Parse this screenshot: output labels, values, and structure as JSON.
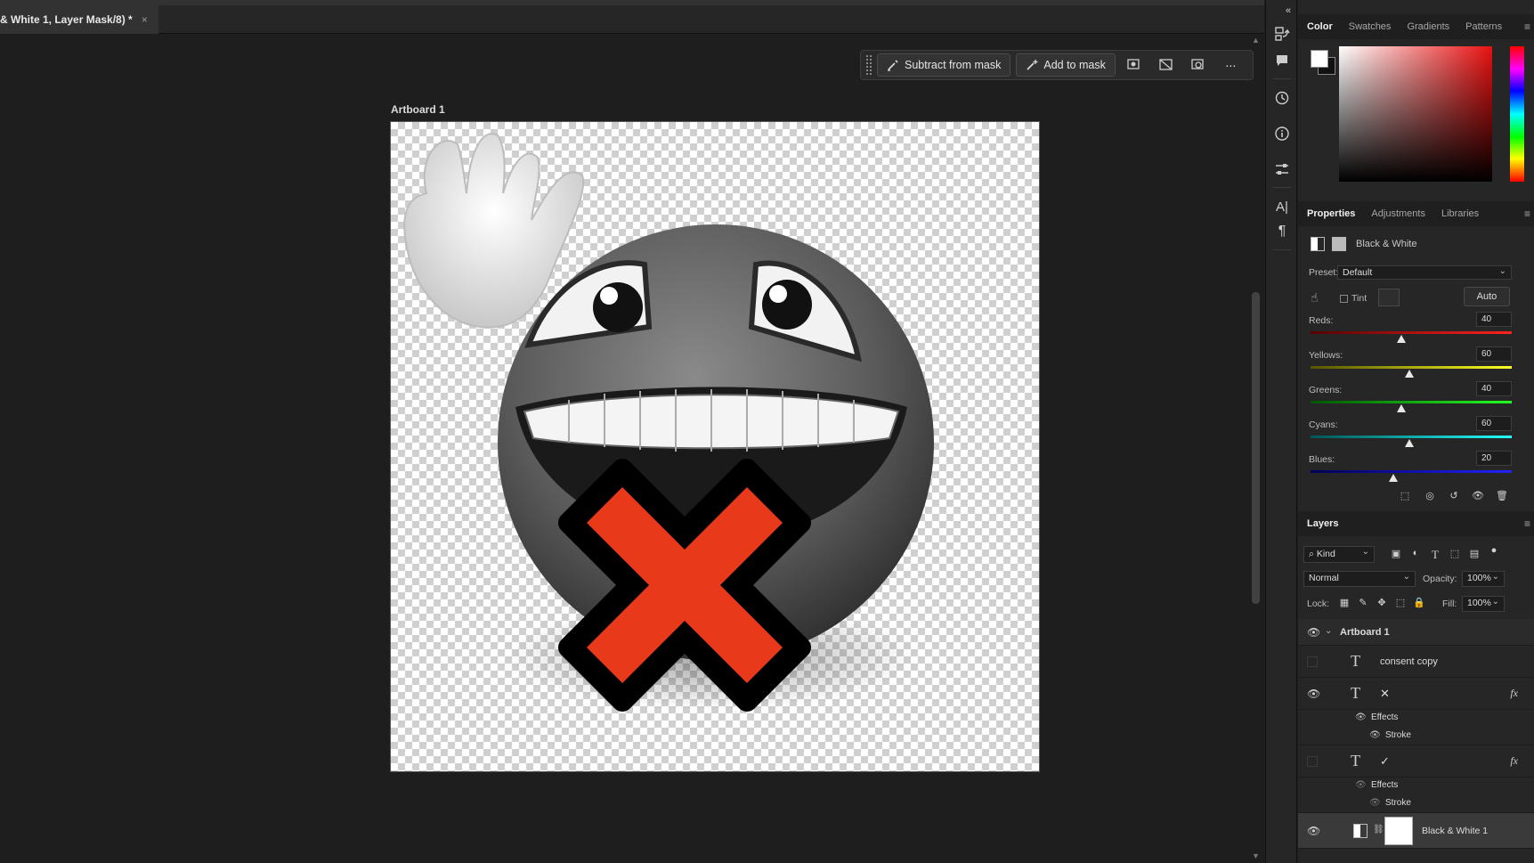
{
  "document": {
    "tab_title": "& White 1, Layer Mask/8) *",
    "close_glyph": "×"
  },
  "taskbar": {
    "subtract_label": "Subtract from mask",
    "add_label": "Add to mask",
    "more_glyph": "···"
  },
  "canvas": {
    "artboard_label": "Artboard 1"
  },
  "icon_strip": {
    "collapse_glyph": "«",
    "icons": [
      "layer-comps-icon",
      "comment-icon",
      "history-icon",
      "info-icon",
      "adjustments-icon",
      "character-icon",
      "paragraph-icon"
    ]
  },
  "color_panel": {
    "tabs": [
      "Color",
      "Swatches",
      "Gradients",
      "Patterns"
    ],
    "foreground": "#ffffff",
    "background": "#111111",
    "hue_color": "#e81010"
  },
  "properties_panel": {
    "tabs": [
      "Properties",
      "Adjustments",
      "Libraries"
    ],
    "adjustment_name": "Black & White",
    "preset_label": "Preset:",
    "preset_value": "Default",
    "tint_label": "Tint",
    "auto_label": "Auto",
    "sliders": [
      {
        "label": "Reds:",
        "value": "40",
        "fraction": 0.45,
        "gradient": "linear-gradient(to right, #500, #f22)"
      },
      {
        "label": "Yellows:",
        "value": "60",
        "fraction": 0.49,
        "gradient": "linear-gradient(to right, #550, #ff2)"
      },
      {
        "label": "Greens:",
        "value": "40",
        "fraction": 0.45,
        "gradient": "linear-gradient(to right, #050, #2f2)"
      },
      {
        "label": "Cyans:",
        "value": "60",
        "fraction": 0.49,
        "gradient": "linear-gradient(to right, #055, #2ff)"
      },
      {
        "label": "Blues:",
        "value": "20",
        "fraction": 0.41,
        "gradient": "linear-gradient(to right, #005, #22f)"
      }
    ]
  },
  "layers_panel": {
    "title": "Layers",
    "kind_label": "Kind",
    "blend_mode": "Normal",
    "opacity_label": "Opacity:",
    "opacity_value": "100%",
    "lock_label": "Lock:",
    "fill_label": "Fill:",
    "fill_value": "100%",
    "layers": [
      {
        "name": "Artboard 1",
        "kind": "artboard",
        "visible": true
      },
      {
        "name": "consent copy",
        "kind": "text",
        "visible": false
      },
      {
        "name": "✕",
        "kind": "text",
        "visible": true,
        "fx": true
      },
      {
        "name": "Effects",
        "kind": "effects"
      },
      {
        "name": "Stroke",
        "kind": "stroke"
      },
      {
        "name": "✓",
        "kind": "text",
        "visible": false,
        "fx": true
      },
      {
        "name": "Effects",
        "kind": "effects"
      },
      {
        "name": "Stroke",
        "kind": "stroke"
      },
      {
        "name": "Black & White 1",
        "kind": "adjustment",
        "visible": true
      }
    ]
  }
}
